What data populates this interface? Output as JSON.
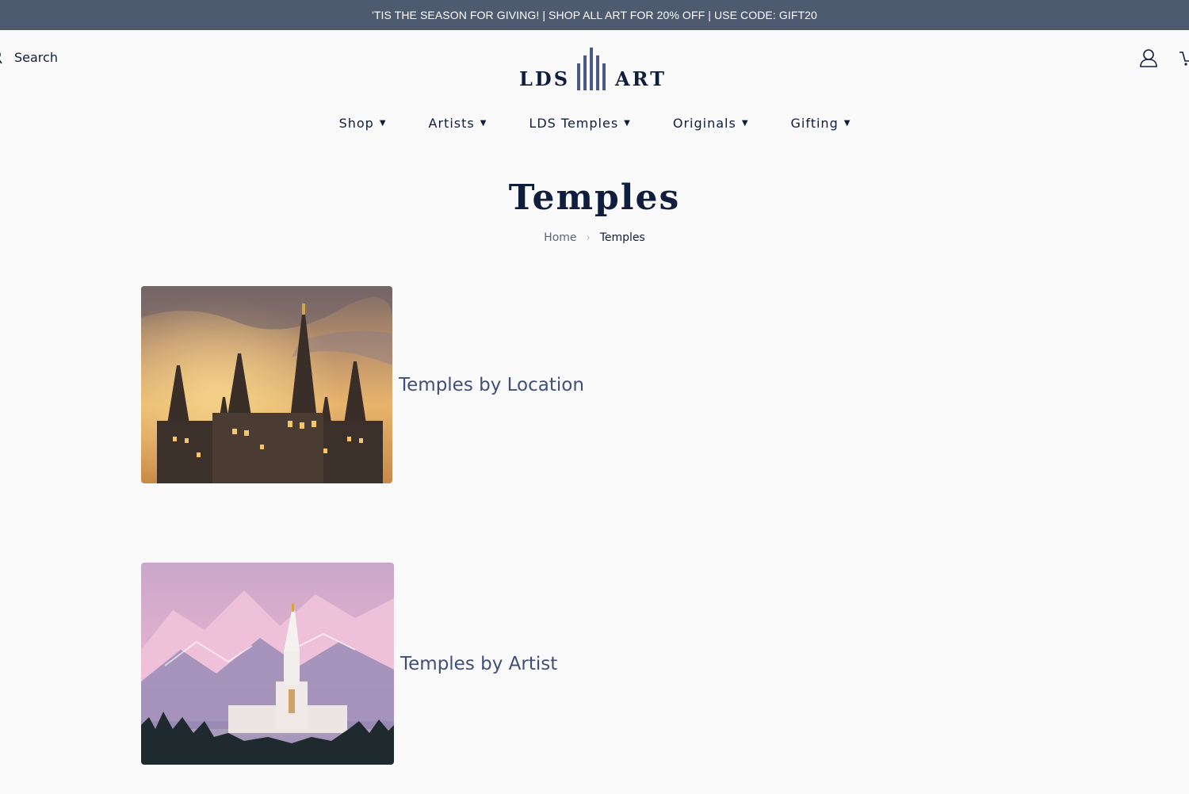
{
  "announcement": "'TIS THE SEASON FOR GIVING! | SHOP ALL ART FOR 20% OFF | USE CODE: GIFT20",
  "header": {
    "search_label": "Search",
    "logo": {
      "left": "LDS",
      "right": "ART"
    },
    "icons": [
      "search-icon",
      "account-icon",
      "cart-icon"
    ]
  },
  "nav": {
    "items": [
      {
        "label": "Shop",
        "caret": "▼"
      },
      {
        "label": "Artists",
        "caret": "▼"
      },
      {
        "label": "LDS Temples",
        "caret": "▼"
      },
      {
        "label": "Originals",
        "caret": "▼"
      },
      {
        "label": "Gifting",
        "caret": "▼"
      }
    ]
  },
  "page": {
    "title": "Temples",
    "breadcrumb": {
      "home": "Home",
      "separator": "›",
      "current": "Temples"
    }
  },
  "collections": [
    {
      "label": "Temples by Location",
      "image": "temple-spires-at-sunset"
    },
    {
      "label": "Temples by Artist",
      "image": "temple-with-pink-mountains"
    }
  ],
  "colors": {
    "announcement_bg": "#4e5a6f",
    "navy": "#0f1e3c",
    "link": "#3f4f75",
    "logo_bars": "#4a5a86"
  }
}
